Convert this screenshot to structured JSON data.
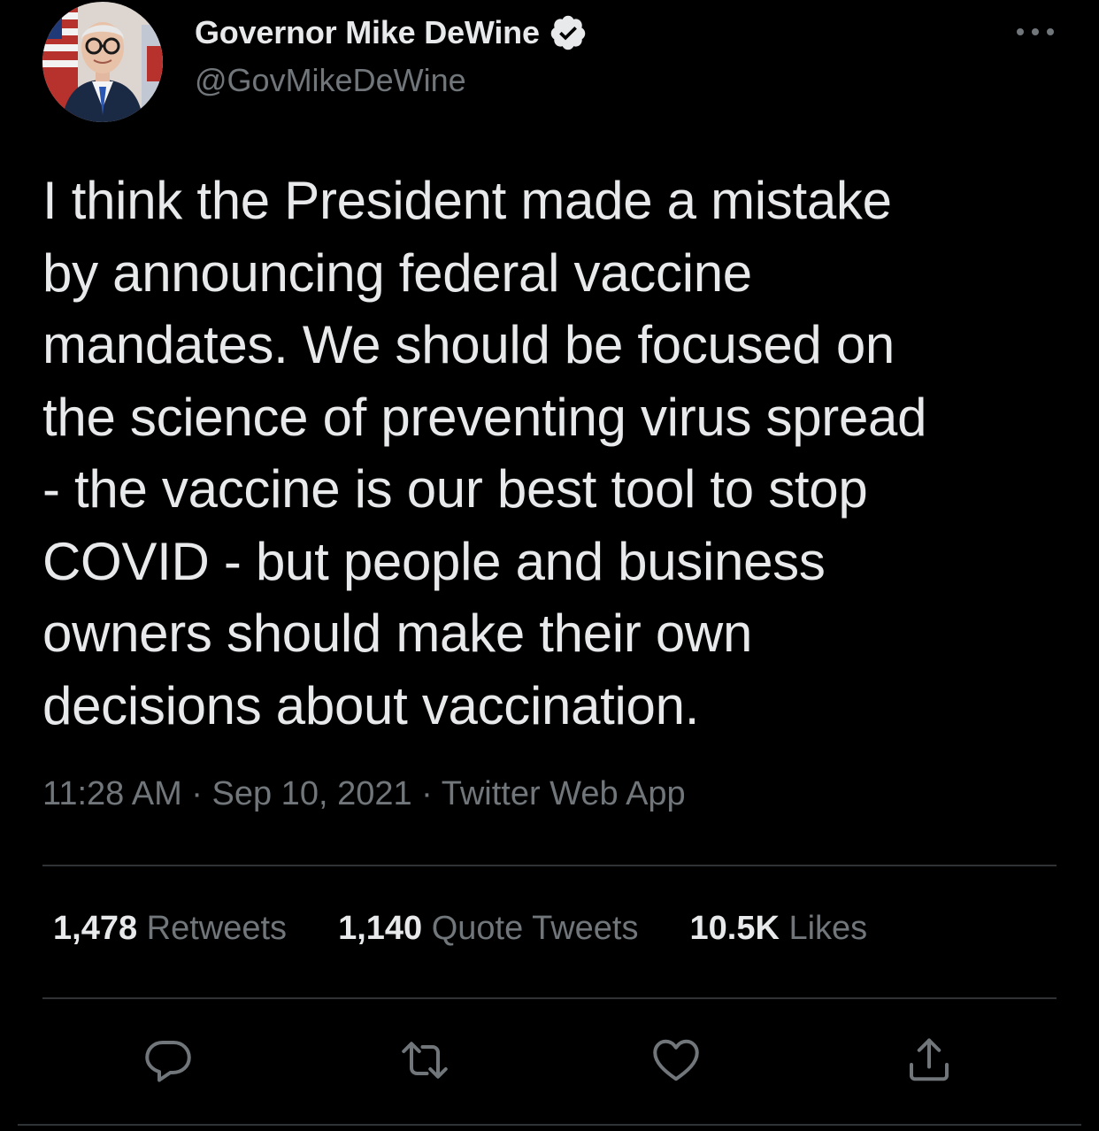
{
  "author": {
    "display_name": "Governor Mike DeWine",
    "handle": "@GovMikeDeWine",
    "verified": true
  },
  "tweet": {
    "text_lines": [
      "I think the President made a mistake",
      "by announcing federal vaccine",
      "mandates. We should be focused on",
      "the science of preventing virus spread",
      "- the vaccine is our best tool to stop",
      "COVID - but people and business",
      "owners should make their own",
      "decisions about vaccination."
    ],
    "time": "11:28 AM",
    "date": "Sep 10, 2021",
    "source": "Twitter Web App",
    "separator": "·"
  },
  "stats": {
    "retweets": {
      "count": "1,478",
      "label": "Retweets"
    },
    "quote_tweets": {
      "count": "1,140",
      "label": "Quote Tweets"
    },
    "likes": {
      "count": "10.5K",
      "label": "Likes"
    }
  },
  "icons": {
    "more": "more-horizontal-icon",
    "verified": "verified-badge-icon",
    "reply": "reply-icon",
    "retweet": "retweet-icon",
    "like": "heart-icon",
    "share": "share-icon"
  },
  "colors": {
    "background": "#000000",
    "text_primary": "#e7e9ea",
    "text_secondary": "#71767b",
    "divider": "#2f3336"
  }
}
